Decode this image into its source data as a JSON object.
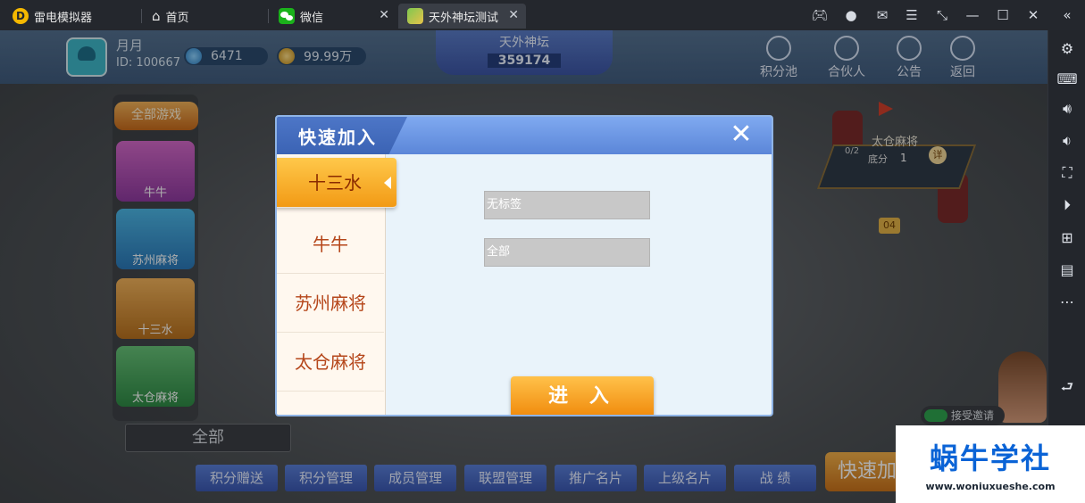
{
  "window": {
    "tabs": [
      {
        "label": "雷电模拟器"
      },
      {
        "label": "首页"
      },
      {
        "label": "微信"
      },
      {
        "label": "天外神坛测试"
      }
    ]
  },
  "player": {
    "name": "月月",
    "id": "ID: 100667",
    "gems": "6471",
    "score": "99.99万"
  },
  "venue": {
    "name": "天外神坛",
    "number": "359174"
  },
  "top_buttons": [
    "积分池",
    "合伙人",
    "公告",
    "返回"
  ],
  "left_menu": {
    "all_games": "全部游戏",
    "games": [
      "牛牛",
      "苏州麻将",
      "十三水",
      "太仓麻将"
    ]
  },
  "bottom": {
    "all_label": "全部",
    "nav": [
      "积分赠送",
      "积分管理",
      "成员管理",
      "联盟管理",
      "推广名片",
      "上级名片",
      "战 绩"
    ],
    "quick_join": "快速加"
  },
  "table": {
    "title": "太仓麻将",
    "seats": "0/2",
    "score_label": "底分",
    "score_value": "1",
    "detail": "详",
    "number": "04"
  },
  "invite": {
    "label": "接受邀请"
  },
  "modal": {
    "title": "快速加入",
    "game_list": [
      {
        "label": "十三水",
        "active": true
      },
      {
        "label": "牛牛",
        "active": false
      },
      {
        "label": "苏州麻将",
        "active": false
      },
      {
        "label": "太仓麻将",
        "active": false
      }
    ],
    "filters": [
      "无标签",
      "全部"
    ],
    "enter_label": "进 入"
  },
  "watermark": {
    "title": "蜗牛学社",
    "url": "www.woniuxueshe.com"
  },
  "colors": {
    "accent_orange": "#f29a15",
    "header_blue": "#5b86d8",
    "watermark_blue": "#0a63d6"
  }
}
